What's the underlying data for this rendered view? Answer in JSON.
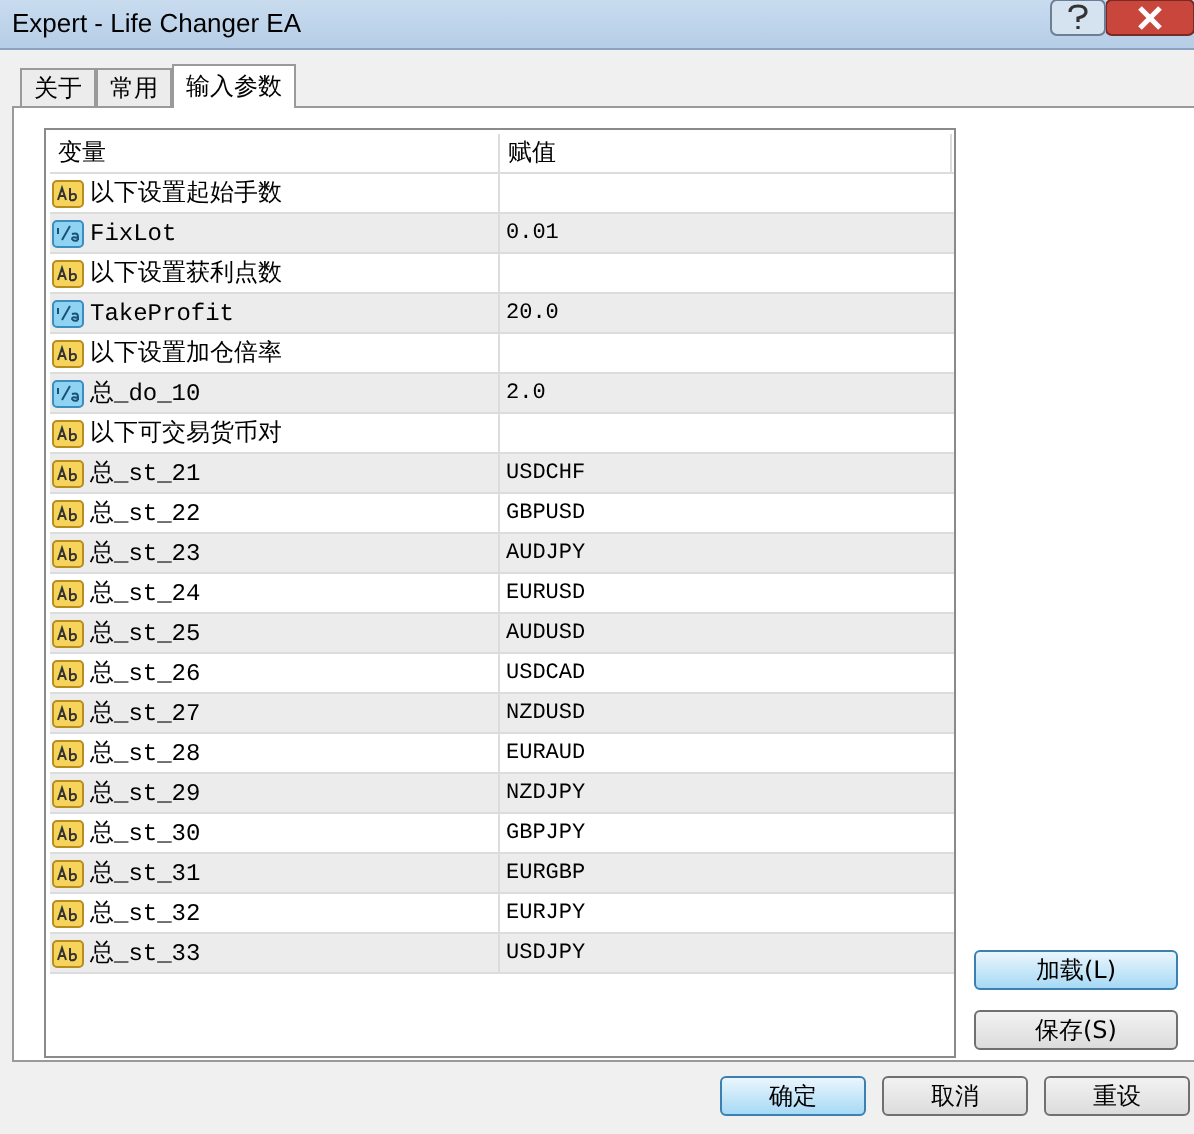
{
  "window": {
    "title": "Expert - Life Changer EA"
  },
  "tabs": [
    {
      "label": "关于",
      "selected": false
    },
    {
      "label": "常用",
      "selected": false
    },
    {
      "label": "输入参数",
      "selected": true
    }
  ],
  "table": {
    "columns": [
      "变量",
      "赋值"
    ],
    "rows": [
      {
        "kind": "string",
        "name": "以下设置起始手数"
      },
      {
        "kind": "double",
        "name": "FixLot",
        "value": "0.01"
      },
      {
        "kind": "string",
        "name": "以下设置获利点数"
      },
      {
        "kind": "double",
        "name": "TakeProfit",
        "value": "20.0"
      },
      {
        "kind": "string",
        "name": "以下设置加仓倍率"
      },
      {
        "kind": "double",
        "name": "总_do_10",
        "value": "2.0"
      },
      {
        "kind": "string",
        "name": "以下可交易货币对"
      },
      {
        "kind": "string",
        "name": "总_st_21",
        "value": "USDCHF"
      },
      {
        "kind": "string",
        "name": "总_st_22",
        "value": "GBPUSD"
      },
      {
        "kind": "string",
        "name": "总_st_23",
        "value": "AUDJPY"
      },
      {
        "kind": "string",
        "name": "总_st_24",
        "value": "EURUSD"
      },
      {
        "kind": "string",
        "name": "总_st_25",
        "value": "AUDUSD"
      },
      {
        "kind": "string",
        "name": "总_st_26",
        "value": "USDCAD"
      },
      {
        "kind": "string",
        "name": "总_st_27",
        "value": "NZDUSD"
      },
      {
        "kind": "string",
        "name": "总_st_28",
        "value": "EURAUD"
      },
      {
        "kind": "string",
        "name": "总_st_29",
        "value": "NZDJPY"
      },
      {
        "kind": "string",
        "name": "总_st_30",
        "value": "GBPJPY"
      },
      {
        "kind": "string",
        "name": "总_st_31",
        "value": "EURGBP"
      },
      {
        "kind": "string",
        "name": "总_st_32",
        "value": "EURJPY"
      },
      {
        "kind": "string",
        "name": "总_st_33",
        "value": "USDJPY"
      }
    ]
  },
  "side_buttons": [
    "加载(L)",
    "保存(S)"
  ],
  "buttons": [
    {
      "label": "确定",
      "default": true
    },
    {
      "label": "取消",
      "default": false
    },
    {
      "label": "重设",
      "default": false
    }
  ]
}
